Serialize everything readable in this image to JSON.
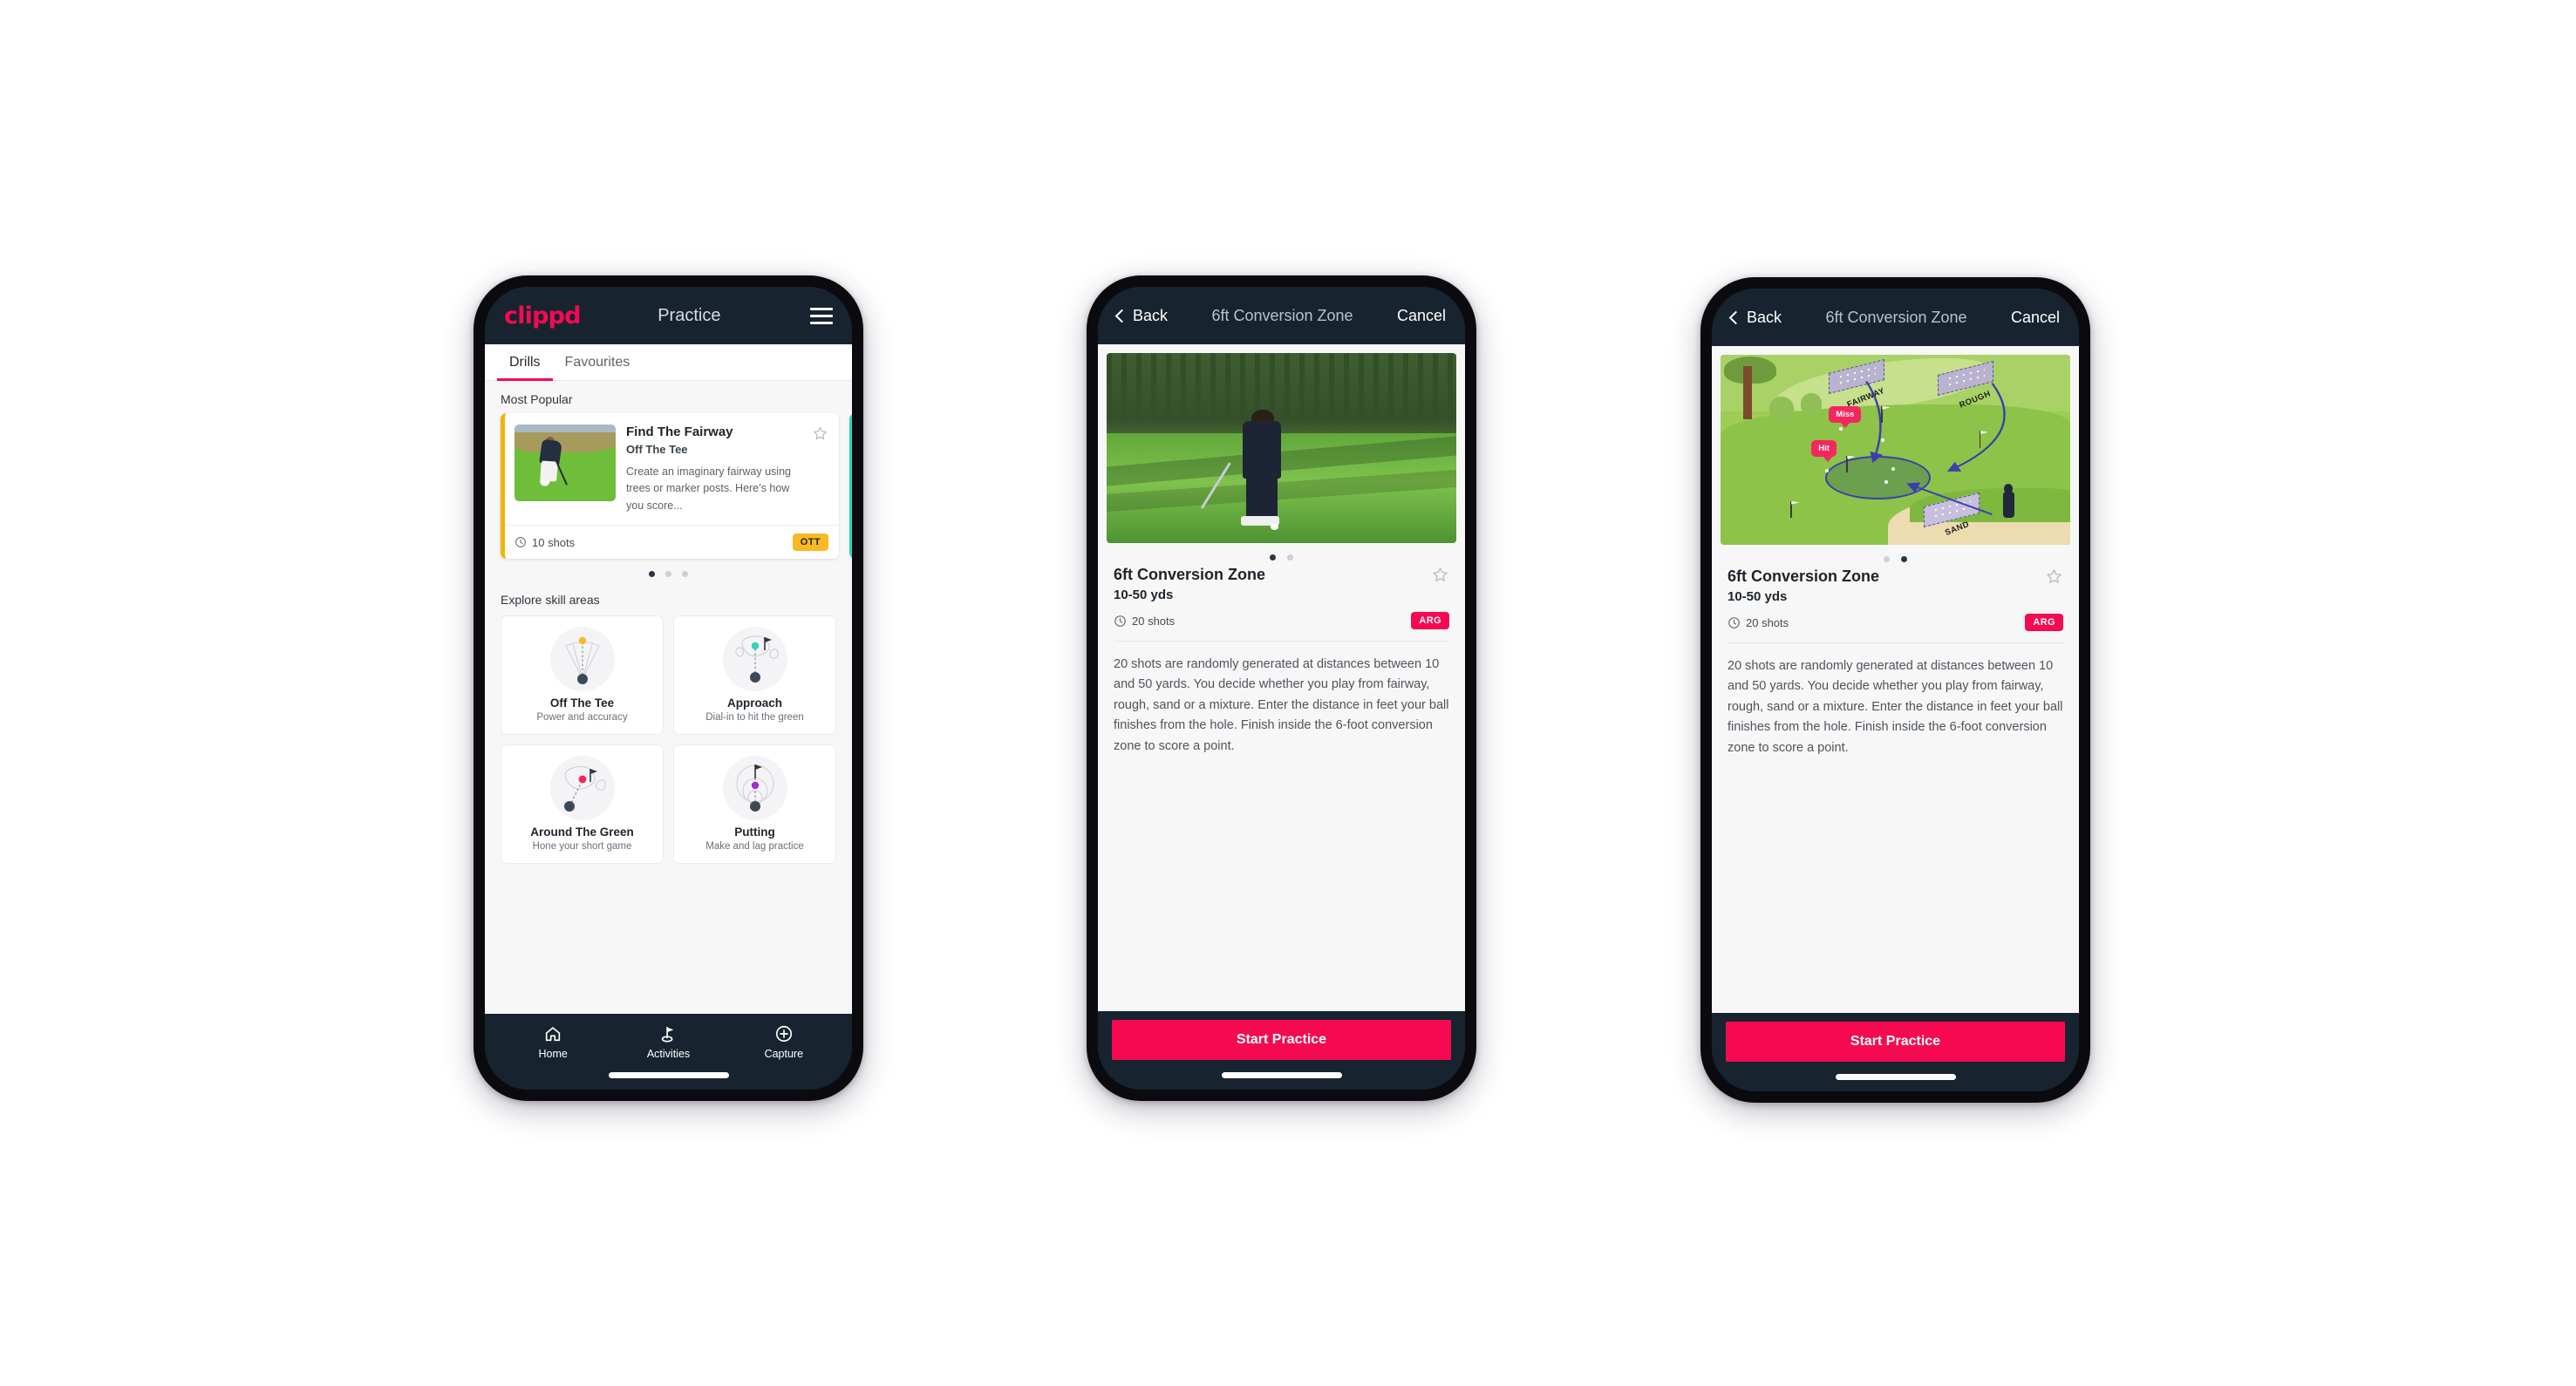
{
  "colors": {
    "brand_pink": "#f50a52",
    "dark_navy": "#17242f",
    "amber": "#f9b926",
    "teal": "#2fd4bd",
    "page_bg": "#f7f7f8"
  },
  "phone1": {
    "app_bar": {
      "brand": "clippd",
      "title": "Practice",
      "menu_icon": "hamburger-icon"
    },
    "tabs": [
      {
        "label": "Drills",
        "active": true
      },
      {
        "label": "Favourites",
        "active": false
      }
    ],
    "most_popular": {
      "heading": "Most Popular",
      "card": {
        "title": "Find The Fairway",
        "subtitle": "Off The Tee",
        "description": "Create an imaginary fairway using trees or marker posts. Here’s how you score...",
        "shots": "10 shots",
        "badge": "OTT",
        "favourite_icon": "star-outline-icon",
        "shots_icon": "clock-icon"
      },
      "dots": [
        {
          "active": true
        },
        {
          "active": false
        },
        {
          "active": false
        }
      ]
    },
    "skill_areas": {
      "heading": "Explore skill areas",
      "cards": [
        {
          "name": "Off The Tee",
          "desc": "Power and accuracy",
          "art": "tee-fan-icon",
          "accent": "#f9b926"
        },
        {
          "name": "Approach",
          "desc": "Dial-in to hit the green",
          "art": "green-target-icon",
          "accent": "#2fd4bd"
        },
        {
          "name": "Around The Green",
          "desc": "Hone your short game",
          "art": "chip-green-icon",
          "accent": "#f5275f"
        },
        {
          "name": "Putting",
          "desc": "Make and lag practice",
          "art": "putting-rings-icon",
          "accent": "#a12bd8"
        }
      ]
    },
    "bottom_nav": [
      {
        "label": "Home",
        "icon": "home-icon",
        "active": false
      },
      {
        "label": "Activities",
        "icon": "golf-flag-icon",
        "active": true
      },
      {
        "label": "Capture",
        "icon": "plus-circle-icon",
        "active": false
      }
    ]
  },
  "phone2": {
    "nav": {
      "back": "Back",
      "title": "6ft Conversion Zone",
      "cancel": "Cancel",
      "back_icon": "chevron-left-icon"
    },
    "hero_media": "golfer-chipping-photo",
    "dots": [
      {
        "active": true
      },
      {
        "active": false
      }
    ],
    "detail": {
      "title": "6ft Conversion Zone",
      "range": "10-50 yds",
      "shots": "20 shots",
      "badge": "ARG",
      "favourite_icon": "star-outline-icon",
      "shots_icon": "clock-icon",
      "description": "20 shots are randomly generated at distances between 10 and 50 yards. You decide whether you play from fairway, rough, sand or a mixture. Enter the distance in feet your ball finishes from the hole. Finish inside the 6-foot conversion zone to score a point."
    },
    "cta": "Start Practice"
  },
  "phone3": {
    "nav": {
      "back": "Back",
      "title": "6ft Conversion Zone",
      "cancel": "Cancel",
      "back_icon": "chevron-left-icon"
    },
    "hero_media": "green-diagram-illustration",
    "illustration_labels": {
      "fairway": "FAIRWAY",
      "rough": "ROUGH",
      "sand": "SAND",
      "miss": "Miss",
      "hit": "Hit"
    },
    "dots": [
      {
        "active": false
      },
      {
        "active": true
      }
    ],
    "detail": {
      "title": "6ft Conversion Zone",
      "range": "10-50 yds",
      "shots": "20 shots",
      "badge": "ARG",
      "favourite_icon": "star-outline-icon",
      "shots_icon": "clock-icon",
      "description": "20 shots are randomly generated at distances between 10 and 50 yards. You decide whether you play from fairway, rough, sand or a mixture. Enter the distance in feet your ball finishes from the hole. Finish inside the 6-foot conversion zone to score a point."
    },
    "cta": "Start Practice"
  }
}
